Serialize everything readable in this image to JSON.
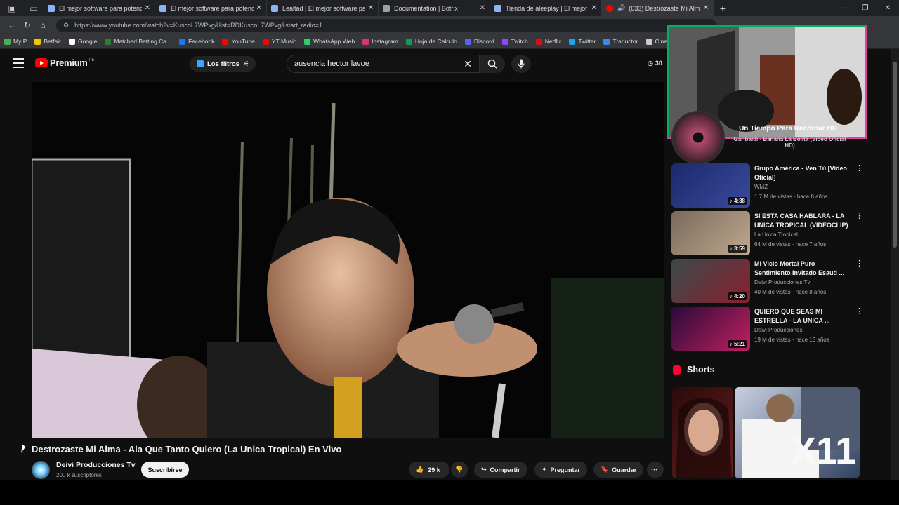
{
  "browser": {
    "tabs": [
      {
        "title": "El mejor software para potenciar",
        "color": "#8ab4f8"
      },
      {
        "title": "El mejor software para potenciar",
        "color": "#8ab4f8"
      },
      {
        "title": "Lealtad | El mejor software para p",
        "color": "#8ab4f8"
      },
      {
        "title": "Documentation | Botrix",
        "color": "#9aa0a6"
      },
      {
        "title": "Tienda de aleeplay | El mejor soft",
        "color": "#8ab4f8"
      },
      {
        "title": "(633) Destrozaste Mi Alma -",
        "color": "#ff0000"
      }
    ],
    "url": "https://www.youtube.com/watch?v=KuscoL7WPvg&list=RDKuscoL7WPvg&start_radio=1",
    "bookmarks": [
      {
        "label": "MyIP",
        "color": "#4caf50"
      },
      {
        "label": "Betfair",
        "color": "#f5c400"
      },
      {
        "label": "Google",
        "color": "#ffffff"
      },
      {
        "label": "Matched Betting Ca...",
        "color": "#2e7d32"
      },
      {
        "label": "Facebook",
        "color": "#1877f2"
      },
      {
        "label": "YouTube",
        "color": "#ff0000"
      },
      {
        "label": "YT Music",
        "color": "#ff0000"
      },
      {
        "label": "WhatsApp Web",
        "color": "#25d366"
      },
      {
        "label": "Instagram",
        "color": "#e1306c"
      },
      {
        "label": "Hoja de Calculo",
        "color": "#0f9d58"
      },
      {
        "label": "Discord",
        "color": "#5865f2"
      },
      {
        "label": "Twitch",
        "color": "#9146ff"
      },
      {
        "label": "Netflix",
        "color": "#e50914"
      },
      {
        "label": "Twitter",
        "color": "#1da1f2"
      },
      {
        "label": "Traductor",
        "color": "#4285f4"
      },
      {
        "label": "Cinepl",
        "color": "#cccccc"
      }
    ]
  },
  "youtube": {
    "logo_text": "Premium",
    "logo_region": "PE",
    "filters_label": "Los filtros",
    "search_value": "ausencia hector lavoe",
    "header_right": "30"
  },
  "video": {
    "title": "Destrozaste Mi Alma - Ala Que Tanto Quiero (La Unica Tropical) En Vivo",
    "channel": "Deivi Producciones Tv",
    "subscribers": "200 k suscriptores",
    "subscribe_label": "Suscribirse",
    "likes": "29 k",
    "share_label": "Compartir",
    "ask_label": "Preguntar",
    "save_label": "Guardar"
  },
  "overlay": {
    "now_playing_title": "Un Tiempo Para Recordar HD",
    "now_playing_subtitle": "Garibaldi - Banana La Bolita (Video Oficial HD)"
  },
  "related": [
    {
      "title": "Grupo América - Ven Tú [Video Oficial]",
      "channel": "WMZ",
      "meta": "1.7 M de vistas · hace 8 años",
      "duration": "4:38",
      "thumb": [
        "#1a2a6c",
        "#3a4a9c"
      ]
    },
    {
      "title": "SI ESTA CASA HABLARA - LA UNICA TROPICAL (VIDEOCLIP)",
      "channel": "La Unica Tropical",
      "meta": "64 M de vistas · hace 7 años",
      "duration": "3:59",
      "thumb": [
        "#7a6a5a",
        "#c0a890"
      ]
    },
    {
      "title": "Mi Vicio Mortal Puro Sentimiento Invitado Esaud ...",
      "channel": "Deivi Producciones Tv",
      "meta": "40 M de vistas · hace 8 años",
      "duration": "4:20",
      "thumb": [
        "#3a4a4a",
        "#8a2030"
      ]
    },
    {
      "title": "QUIERO QUE SEAS MI ESTRELLA - LA UNICA ...",
      "channel": "Deivi Producciones",
      "meta": "19 M de vistas · hace 13 años",
      "duration": "5:21",
      "thumb": [
        "#2a0a3a",
        "#c02060"
      ]
    }
  ],
  "shorts": {
    "heading": "Shorts",
    "items": [
      {
        "caption": "",
        "thumb": [
          "#2a0a0a",
          "#6a2020"
        ]
      },
      {
        "caption": "x11",
        "thumb": [
          "#c8d0e0",
          "#304060"
        ]
      }
    ]
  }
}
